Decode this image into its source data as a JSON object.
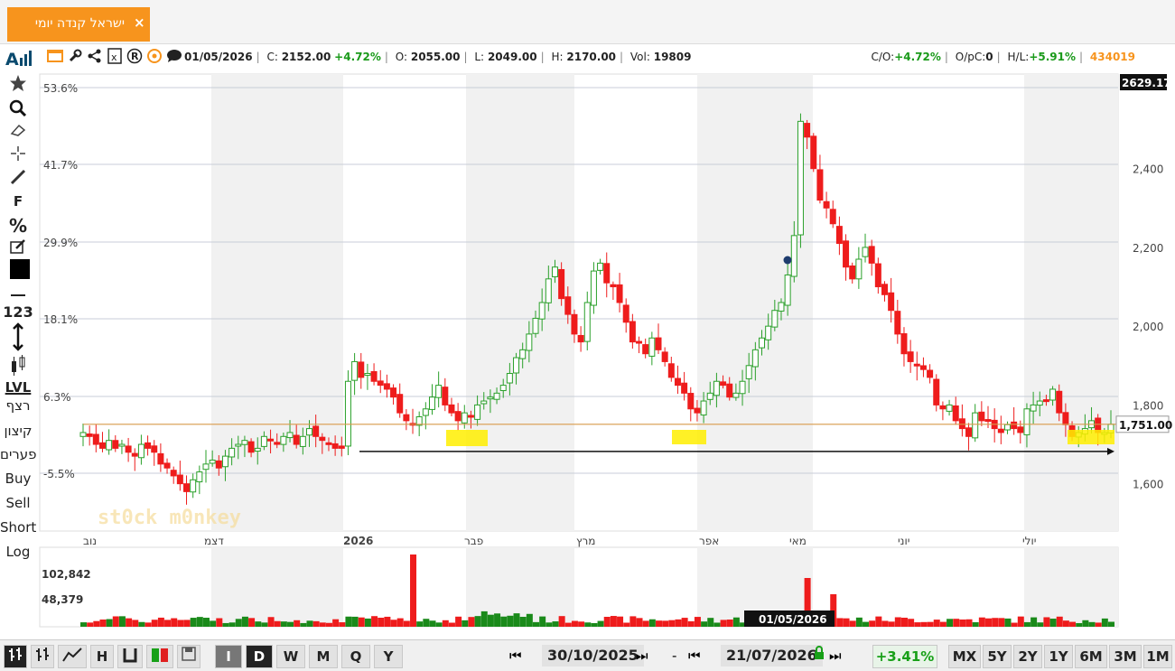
{
  "tab": {
    "title": "ישראל קנדה יומי",
    "close_label": "×"
  },
  "logo_text": "Aıll",
  "toolbar_icons": [
    "monitor-icon",
    "wrench-icon",
    "share-icon",
    "excel-icon",
    "registered-icon",
    "target-icon",
    "chat-icon"
  ],
  "toolbar_glyphs": [
    "▭",
    "🔧",
    "⋖",
    "x",
    "®",
    "◉",
    "💬"
  ],
  "stats": {
    "date": "01/05/2026",
    "c_label": "C:",
    "c_value": "2152.00",
    "c_change": "+4.72%",
    "o_label": "O:",
    "o_value": "2055.00",
    "l_label": "L:",
    "l_value": "2049.00",
    "h_label": "H:",
    "h_value": "2170.00",
    "vol_label": "Vol:",
    "vol_value": "19809",
    "co_label": "C/O:",
    "co_value": "+4.72%",
    "opc_label": "O/pC:",
    "opc_value": "0",
    "hl_label": "H/L:",
    "hl_value": "+5.91%",
    "id": "434019"
  },
  "left_tools": [
    {
      "name": "star-icon",
      "glyph": "★"
    },
    {
      "name": "zoom-icon",
      "glyph": "🔍"
    },
    {
      "name": "eraser-icon",
      "glyph": "⌫"
    },
    {
      "name": "crosshair-icon",
      "glyph": "✛"
    },
    {
      "name": "line-icon",
      "glyph": "╱"
    },
    {
      "name": "fibonacci-icon",
      "glyph": "F"
    },
    {
      "name": "percent-icon",
      "glyph": "%"
    },
    {
      "name": "edit-icon",
      "glyph": "✎"
    },
    {
      "name": "color-swatch",
      "glyph": "■"
    },
    {
      "name": "line-width-icon",
      "glyph": "—"
    },
    {
      "name": "value-icon",
      "glyph": "123"
    },
    {
      "name": "range-icon",
      "glyph": "↕"
    },
    {
      "name": "candles-icon",
      "glyph": "╫"
    },
    {
      "name": "level-icon",
      "glyph": "LVL"
    }
  ],
  "left_labels": [
    "רצף",
    "קיצון",
    "פערים",
    "Buy",
    "Sell",
    "Short",
    "Log"
  ],
  "watermark": "st0ck m0nkey",
  "chart_data": {
    "type": "candlestick",
    "y_left_ticks": [
      "53.6%",
      "41.7%",
      "29.9%",
      "18.1%",
      "6.3%",
      "-5.5%"
    ],
    "y_right_ticks": [
      "2,400",
      "2,200",
      "2,000",
      "1,800",
      "1,600"
    ],
    "y_right_values": [
      2400,
      2200,
      2000,
      1800,
      1600
    ],
    "ylim": [
      1480,
      2640
    ],
    "last_price_label": "2629.17",
    "current_price_label": "1,751.00",
    "current_price": 1751,
    "support_level": 1682,
    "x_labels": [
      "נוב",
      "דצמ",
      "2026",
      "פבר",
      "מרץ",
      "אפר",
      "מאי",
      "יוני",
      "יולי"
    ],
    "volume_ticks": [
      "102,842",
      "48,379"
    ],
    "volume_values": [
      102842,
      48379
    ],
    "cursor_date": "01/05/2026",
    "approx_close": [
      1730,
      1720,
      1700,
      1690,
      1710,
      1690,
      1700,
      1680,
      1670,
      1700,
      1690,
      1680,
      1650,
      1640,
      1620,
      1600,
      1580,
      1610,
      1630,
      1650,
      1660,
      1640,
      1670,
      1690,
      1700,
      1710,
      1680,
      1690,
      1720,
      1710,
      1700,
      1720,
      1730,
      1700,
      1720,
      1740,
      1720,
      1710,
      1700,
      1690,
      1690,
      1860,
      1910,
      1870,
      1880,
      1860,
      1850,
      1840,
      1820,
      1780,
      1760,
      1750,
      1770,
      1790,
      1820,
      1850,
      1800,
      1780,
      1760,
      1780,
      1770,
      1800,
      1810,
      1820,
      1830,
      1850,
      1880,
      1920,
      1940,
      1980,
      2020,
      2060,
      2120,
      2150,
      2070,
      2030,
      1980,
      1960,
      2060,
      2140,
      2160,
      2110,
      2100,
      2060,
      2010,
      1960,
      1960,
      1930,
      1970,
      1940,
      1910,
      1870,
      1850,
      1830,
      1790,
      1780,
      1810,
      1830,
      1860,
      1850,
      1820,
      1830,
      1860,
      1900,
      1940,
      1970,
      2000,
      2040,
      2060,
      2130,
      2230,
      2520,
      2480,
      2400,
      2320,
      2300,
      2260,
      2210,
      2150,
      2120,
      2170,
      2200,
      2160,
      2100,
      2080,
      2040,
      1980,
      1930,
      1910,
      1900,
      1890,
      1870,
      1800,
      1790,
      1800,
      1760,
      1740,
      1720,
      1780,
      1760,
      1760,
      1740,
      1730,
      1750,
      1740,
      1730,
      1790,
      1800,
      1810,
      1810,
      1840,
      1780,
      1750,
      1720,
      1730,
      1740,
      1760,
      1730,
      1730,
      1751
    ]
  },
  "bottom_bar": {
    "chart_type_icons": [
      "ohlc-icon",
      "line-chart-icon",
      "h-icon",
      "bar-icon",
      "candle-icon",
      "save-icon"
    ],
    "periods": [
      "I",
      "D",
      "W",
      "M",
      "Q",
      "Y"
    ],
    "start_date": "30/10/2025",
    "end_date": "21/07/2026",
    "change": "+3.41%",
    "ranges": [
      "MX",
      "5Y",
      "2Y",
      "1Y",
      "6M",
      "3M",
      "1M"
    ]
  }
}
